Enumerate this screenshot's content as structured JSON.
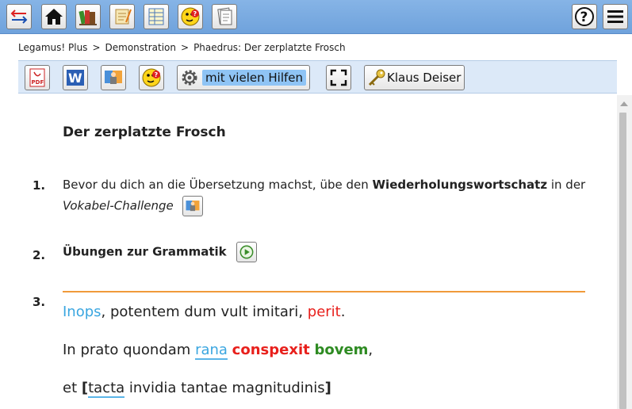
{
  "breadcrumb": {
    "items": [
      "Legamus! Plus",
      "Demonstration",
      "Phaedrus: Der zerplatzte Frosch"
    ],
    "separator": ">"
  },
  "toolbar": {
    "hilfen_label": "mit vielen Hilfen",
    "user_label": "Klaus Deiser"
  },
  "content": {
    "title": "Der zerplatzte Frosch",
    "step1": {
      "number": "1.",
      "text_before": "Bevor du dich an die Übersetzung machst, übe den ",
      "text_bold": "Wiederholungswortschatz",
      "text_after": " in der",
      "text_italic": "Vokabel-Challenge"
    },
    "step2": {
      "number": "2.",
      "label": "Übungen zur Grammatik"
    },
    "step3": {
      "number": "3.",
      "line1": {
        "w1": "Inops",
        "w2": ", potentem dum vult imitari, ",
        "w3": "perit",
        "w4": "."
      },
      "line2": {
        "w1": "In prato quondam ",
        "w2": "rana",
        "w3": "conspexit",
        "w4": "bovem",
        "w5": ","
      },
      "line3": {
        "w1": "et ",
        "w2": "[",
        "w3": "tacta",
        "w4": " invidia tantae magnitudinis",
        "w5": "]"
      }
    }
  },
  "colors": {
    "topbar": "#7aaee3",
    "toolbar2": "#dce9f8",
    "separator": "#f09a3a",
    "blue_word": "#3aa6e0",
    "red_word": "#e8201c",
    "green_word": "#2e8b22"
  },
  "icons": {
    "top_left": [
      "swap-arrows-icon",
      "home-icon",
      "books-icon",
      "scroll-icon",
      "table-icon",
      "question-face-icon",
      "pages-icon"
    ],
    "top_right": [
      "help-icon",
      "menu-icon"
    ],
    "toolbar": [
      "pdf-icon",
      "word-icon",
      "vocab-challenge-icon",
      "question-face-icon",
      "gear-icon",
      "fullscreen-icon",
      "key-icon"
    ]
  }
}
